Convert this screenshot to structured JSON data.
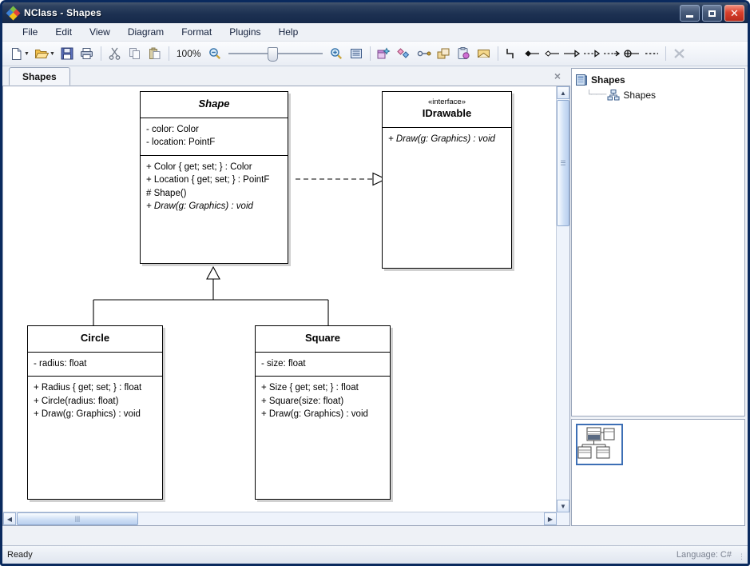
{
  "window": {
    "title": "NClass - Shapes",
    "logo_icon": "nclass-diamonds-logo",
    "minimize_label": "_",
    "maximize_label": "□",
    "close_label": "×"
  },
  "menubar": {
    "items": [
      {
        "label": "File"
      },
      {
        "label": "Edit"
      },
      {
        "label": "View"
      },
      {
        "label": "Diagram"
      },
      {
        "label": "Format"
      },
      {
        "label": "Plugins"
      },
      {
        "label": "Help"
      }
    ]
  },
  "toolbar": {
    "new_label": "New",
    "open_label": "Open",
    "save_label": "Save",
    "print_label": "Print",
    "cut_label": "Cut",
    "copy_label": "Copy",
    "paste_label": "Paste",
    "zoom_value": "100%",
    "zoom_out_label": "Zoom Out",
    "zoom_in_label": "Zoom In",
    "zoom_fit_label": "Zoom to Fit",
    "new_class_label": "New Class",
    "new_structure_label": "New Structure",
    "new_interface_label": "New Interface",
    "new_enum_label": "New Enum",
    "new_delegate_label": "New Delegate",
    "new_comment_label": "New Comment",
    "relation_step_label": "Step Relationship",
    "composition_label": "Composition",
    "aggregation_label": "Aggregation",
    "association_label": "Association",
    "generalization_label": "Generalization",
    "realization_label": "Realization",
    "nesting_label": "Nesting",
    "dependency_label": "Dependency",
    "delete_label": "Delete"
  },
  "tabs": {
    "items": [
      {
        "label": "Shapes"
      }
    ],
    "close_label": "×"
  },
  "project_tree": {
    "root": {
      "label": "Shapes",
      "icon": "project-icon"
    },
    "children": [
      {
        "label": "Shapes",
        "icon": "diagram-icon"
      }
    ]
  },
  "statusbar": {
    "message": "Ready",
    "language": "Language: C#"
  },
  "diagram": {
    "classes": [
      {
        "name": "Shape",
        "abstract": true,
        "stereotype": "",
        "fields": [
          "- color: Color",
          "- location: PointF"
        ],
        "operations": [
          {
            "text": "+ Color { get; set; } : Color",
            "abstract": false
          },
          {
            "text": "+ Location { get; set; } : PointF",
            "abstract": false
          },
          {
            "text": "# Shape()",
            "abstract": false
          },
          {
            "text": "+ Draw(g: Graphics) : void",
            "abstract": true
          }
        ]
      },
      {
        "name": "IDrawable",
        "abstract": false,
        "stereotype": "«interface»",
        "fields": [],
        "operations": [
          {
            "text": "+ Draw(g: Graphics) : void",
            "abstract": true
          }
        ]
      },
      {
        "name": "Circle",
        "abstract": false,
        "stereotype": "",
        "fields": [
          "- radius: float"
        ],
        "operations": [
          {
            "text": "+ Radius { get; set; } : float",
            "abstract": false
          },
          {
            "text": "+ Circle(radius: float)",
            "abstract": false
          },
          {
            "text": "+ Draw(g: Graphics) : void",
            "abstract": false
          }
        ]
      },
      {
        "name": "Square",
        "abstract": false,
        "stereotype": "",
        "fields": [
          "- size: float"
        ],
        "operations": [
          {
            "text": "+ Size { get; set; } : float",
            "abstract": false
          },
          {
            "text": "+ Square(size: float)",
            "abstract": false
          },
          {
            "text": "+ Draw(g: Graphics) : void",
            "abstract": false
          }
        ]
      }
    ],
    "relationships": [
      {
        "type": "realization",
        "from": "Shape",
        "to": "IDrawable"
      },
      {
        "type": "generalization",
        "from": "Circle",
        "to": "Shape"
      },
      {
        "type": "generalization",
        "from": "Square",
        "to": "Shape"
      }
    ]
  }
}
